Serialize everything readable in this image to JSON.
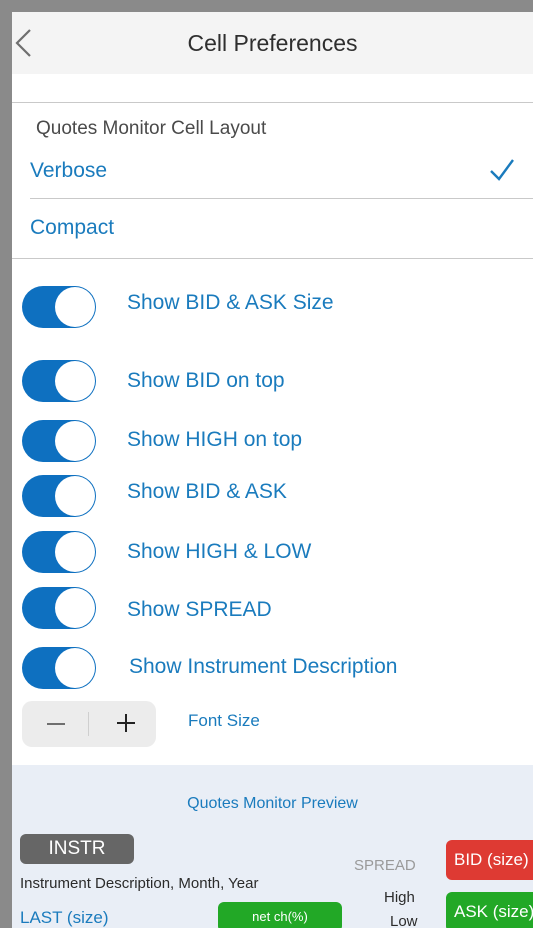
{
  "header": {
    "title": "Cell Preferences",
    "back_icon": "chevron-left-icon"
  },
  "layout_section": {
    "header": "Quotes Monitor Cell Layout",
    "options": [
      {
        "label": "Verbose",
        "selected": true
      },
      {
        "label": "Compact",
        "selected": false
      }
    ],
    "check_glyph": "✓"
  },
  "toggles": [
    {
      "label": "Show BID & ASK Size",
      "on": true
    },
    {
      "label": "Show BID on top",
      "on": true
    },
    {
      "label": "Show HIGH on top",
      "on": true
    },
    {
      "label": "Show BID & ASK",
      "on": true
    },
    {
      "label": "Show HIGH & LOW",
      "on": true
    },
    {
      "label": "Show SPREAD",
      "on": true
    },
    {
      "label": "Show Instrument Description",
      "on": true
    }
  ],
  "font_size": {
    "minus": "—",
    "plus": "+",
    "label": "Font Size"
  },
  "preview": {
    "title": "Quotes Monitor Preview",
    "instr": "INSTR",
    "description": "Instrument Description, Month, Year",
    "last": "LAST (size)",
    "net_change": "net ch(%)",
    "spread": "SPREAD",
    "high": "High",
    "low": "Low",
    "bid": "BID (size)",
    "ask": "ASK (size)"
  },
  "colors": {
    "accent": "#1a7bbd",
    "toggle_on": "#0e70c0",
    "bid": "#de3a33",
    "ask": "#22a826",
    "instr_badge": "#666666"
  }
}
